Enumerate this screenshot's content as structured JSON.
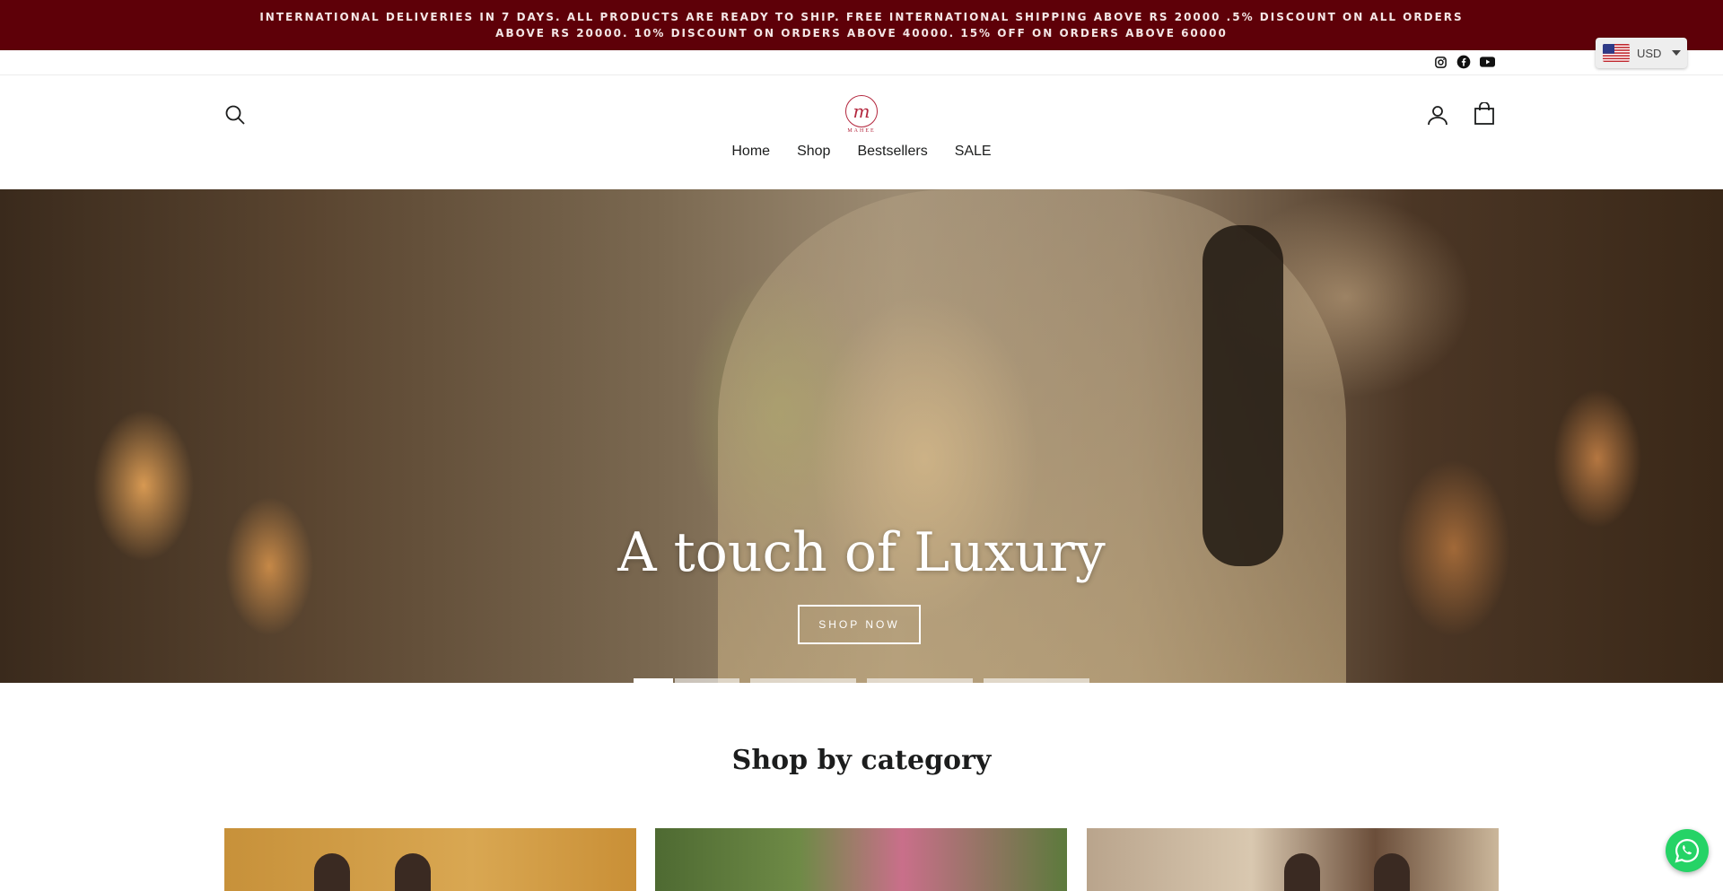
{
  "announcement": {
    "text": "INTERNATIONAL DELIVERIES IN 7 DAYS. ALL PRODUCTS ARE READY TO SHIP. FREE INTERNATIONAL SHIPPING ABOVE RS 20000 .5% DISCOUNT ON ALL ORDERS ABOVE RS 20000. 10% DISCOUNT ON ORDERS ABOVE 40000. 15% OFF ON ORDERS ABOVE 60000",
    "background": "#5e0008"
  },
  "social": {
    "icons": [
      "instagram-icon",
      "facebook-icon",
      "youtube-icon"
    ]
  },
  "currency": {
    "selected": "USD",
    "flag": "us-flag-icon"
  },
  "header": {
    "logo_letter": "m",
    "logo_text": "MAHEE",
    "icons": [
      "search-icon",
      "account-icon",
      "bag-icon"
    ]
  },
  "nav": {
    "items": [
      {
        "label": "Home"
      },
      {
        "label": "Shop"
      },
      {
        "label": "Bestsellers"
      },
      {
        "label": "SALE"
      }
    ]
  },
  "hero": {
    "title": "A touch of Luxury",
    "button_label": "SHOP NOW",
    "active_slide": 1,
    "slide_count": 5
  },
  "category": {
    "title": "Shop by category"
  },
  "colors": {
    "accent": "#5e0008",
    "logo": "#b3263d",
    "whatsapp": "#25d366"
  }
}
